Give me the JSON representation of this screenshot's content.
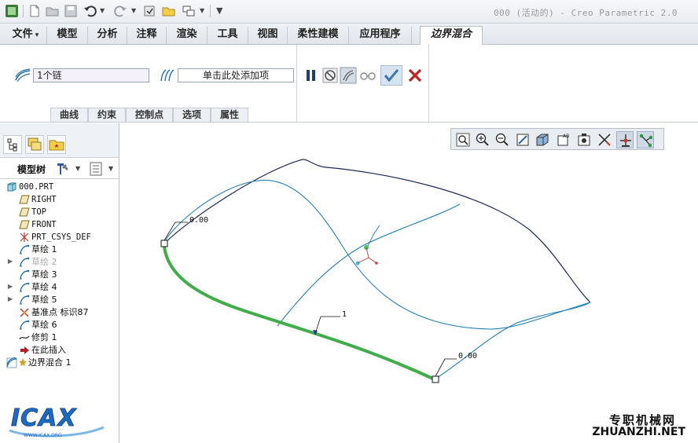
{
  "window": {
    "title": "000 (活动的) - Creo Parametric 2.0",
    "quick_access": [
      "app-logo-icon",
      "new-file-icon",
      "open-folder-icon",
      "save-icon",
      "undo-icon",
      "redo-icon",
      "regenerate-icon",
      "open-folder-icon",
      "window-switch-icon",
      "customize-arrow-icon"
    ]
  },
  "ribbon": {
    "tabs": [
      {
        "label": "文件"
      },
      {
        "label": "模型"
      },
      {
        "label": "分析"
      },
      {
        "label": "注释"
      },
      {
        "label": "渲染"
      },
      {
        "label": "工具"
      },
      {
        "label": "视图"
      },
      {
        "label": "柔性建模"
      },
      {
        "label": "应用程序"
      },
      {
        "label": "边界混合"
      }
    ],
    "active_tab": "边界混合"
  },
  "dashboard": {
    "first_direction_value": "1个链",
    "second_direction_value": "单击此处添加项",
    "subtabs": [
      "曲线",
      "约束",
      "控制点",
      "选项",
      "属性"
    ],
    "controls": [
      "pause-icon",
      "no-preview-icon",
      "verify-preview-icon",
      "preview-glasses-icon",
      "ok-check-icon",
      "cancel-x-icon"
    ]
  },
  "model_tree": {
    "title": "模型树",
    "items": [
      {
        "label": "000.PRT",
        "icon": "part-icon",
        "expander": false,
        "dim": false,
        "indent": 0
      },
      {
        "label": "RIGHT",
        "icon": "datum-plane-icon",
        "expander": false,
        "dim": false,
        "indent": 1
      },
      {
        "label": "TOP",
        "icon": "datum-plane-icon",
        "expander": false,
        "dim": false,
        "indent": 1
      },
      {
        "label": "FRONT",
        "icon": "datum-plane-icon",
        "expander": false,
        "dim": false,
        "indent": 1
      },
      {
        "label": "PRT_CSYS_DEF",
        "icon": "csys-icon",
        "expander": false,
        "dim": false,
        "indent": 1
      },
      {
        "label": "草绘 1",
        "icon": "sketch-icon",
        "expander": false,
        "dim": false,
        "indent": 1
      },
      {
        "label": "草绘 2",
        "icon": "sketch-icon",
        "expander": true,
        "dim": true,
        "indent": 1
      },
      {
        "label": "草绘 3",
        "icon": "sketch-icon",
        "expander": false,
        "dim": false,
        "indent": 1
      },
      {
        "label": "草绘 4",
        "icon": "sketch-icon",
        "expander": true,
        "dim": false,
        "indent": 1
      },
      {
        "label": "草绘 5",
        "icon": "sketch-icon",
        "expander": true,
        "dim": false,
        "indent": 1
      },
      {
        "label": "基准点 标识87",
        "icon": "datum-point-icon",
        "expander": false,
        "dim": false,
        "indent": 1
      },
      {
        "label": "草绘 6",
        "icon": "sketch-icon",
        "expander": false,
        "dim": false,
        "indent": 1
      },
      {
        "label": "修剪 1",
        "icon": "trim-icon",
        "expander": false,
        "dim": false,
        "indent": 1
      },
      {
        "label": "在此插入",
        "icon": "insert-here-arrow-icon",
        "expander": false,
        "dim": false,
        "indent": 1
      },
      {
        "label": "边界混合 1",
        "icon": "boundary-blend-icon",
        "expander": false,
        "dim": false,
        "indent": 0
      }
    ]
  },
  "graphics": {
    "view_toolbar": [
      "refit-icon",
      "zoom-in-icon",
      "zoom-out-icon",
      "repaint-icon",
      "display-style-icon",
      "saved-views-icon",
      "annotation-display-icon",
      "datum-display-icon",
      "spin-center-icon",
      "csys-display-icon",
      "point-display-icon"
    ],
    "annotations": {
      "start_value": "0.00",
      "end_value": "0.00",
      "chain_index": "1"
    },
    "colors": {
      "selected_chain": "#3fae49",
      "surface_edges": "#1f7fb4",
      "boundary_edge": "#1a2b5c"
    }
  },
  "watermark": {
    "logo_text": "ICAX",
    "site_text": "WWW.ICAX.ORG",
    "cn_text": "专职机械网",
    "url_text": "ZHUANZHI.NET"
  }
}
